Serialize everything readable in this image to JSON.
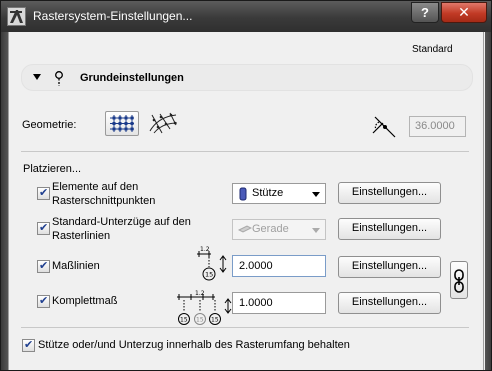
{
  "window": {
    "title": "Rastersystem-Einstellungen...",
    "help_label": "?",
    "close_label": "✕"
  },
  "header": {
    "favorite_label": "Standard"
  },
  "section": {
    "title": "Grundeinstellungen"
  },
  "geometry": {
    "label": "Geometrie:",
    "angle_value": "36.0000"
  },
  "placement": {
    "heading": "Platzieren...",
    "rows": [
      {
        "label_line1": "Elemente auf den",
        "label_line2": "Rasterschnittpunkten",
        "checked": true,
        "dropdown_value": "Stütze",
        "button_label": "Einstellungen..."
      },
      {
        "label_line1": "Standard-Unterzüge auf den",
        "label_line2": "Rasterlinien",
        "checked": true,
        "dropdown_value": "Gerade",
        "dropdown_disabled": true,
        "button_label": "Einstellungen..."
      },
      {
        "label": "Maßlinien",
        "checked": true,
        "value": "2.0000",
        "button_label": "Einstellungen..."
      },
      {
        "label": "Komplettmaß",
        "checked": true,
        "value": "1.0000",
        "button_label": "Einstellungen..."
      }
    ]
  },
  "diagram": {
    "dim_label": "1.2",
    "marker_label": "15"
  },
  "footer": {
    "checked": true,
    "label": "Stütze oder/und Unterzug innerhalb des Rasterumfang behalten"
  }
}
